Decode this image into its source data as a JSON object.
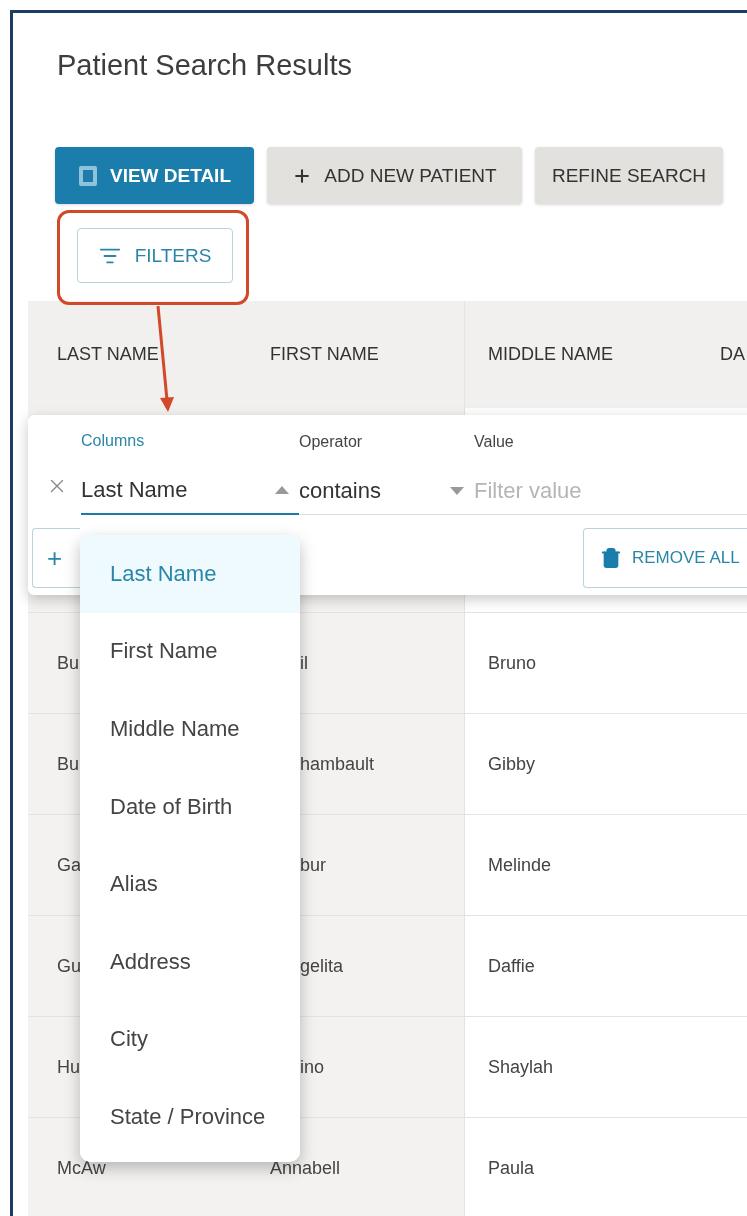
{
  "page": {
    "title": "Patient Search Results"
  },
  "toolbar": [
    {
      "label": "VIEW DETAIL",
      "kind": "primary"
    },
    {
      "label": "ADD NEW PATIENT",
      "kind": "add"
    },
    {
      "label": "REFINE SEARCH",
      "kind": "secondary"
    }
  ],
  "filters_button": {
    "label": "FILTERS"
  },
  "table": {
    "columns": [
      "LAST NAME",
      "FIRST NAME",
      "MIDDLE NAME",
      "DA"
    ],
    "rows": [
      {
        "last_name": "Bu",
        "first_name": "il",
        "middle_name": "Bruno",
        "partly_hidden": true
      },
      {
        "last_name": "Bu",
        "first_name": "hambault",
        "middle_name": "Gibby",
        "partly_hidden": true
      },
      {
        "last_name": "Ga",
        "first_name": "bur",
        "middle_name": "Melinde",
        "partly_hidden": true
      },
      {
        "last_name": "Gu",
        "first_name": "gelita",
        "middle_name": "Daffie",
        "partly_hidden": true
      },
      {
        "last_name": "Hu",
        "first_name": "ino",
        "middle_name": "Shaylah",
        "partly_hidden": true
      },
      {
        "last_name": "McAw",
        "first_name": "Annabell",
        "middle_name": "Paula",
        "partly_hidden": false
      }
    ]
  },
  "filter_panel": {
    "columns_field": {
      "label": "Columns",
      "value": "Last Name",
      "expanded": true
    },
    "operator_field": {
      "label": "Operator",
      "value": "contains",
      "expanded": false
    },
    "value_field": {
      "label": "Value",
      "placeholder": "Filter value"
    },
    "add_button": {
      "label": "+"
    },
    "remove_all_button": {
      "label": "REMOVE ALL"
    }
  },
  "column_menu": [
    {
      "label": "Last Name",
      "selected": true
    },
    {
      "label": "First Name",
      "selected": false
    },
    {
      "label": "Middle Name",
      "selected": false
    },
    {
      "label": "Date of Birth",
      "selected": false
    },
    {
      "label": "Alias",
      "selected": false
    },
    {
      "label": "Address",
      "selected": false
    },
    {
      "label": "City",
      "selected": false
    },
    {
      "label": "State / Province",
      "selected": false
    }
  ]
}
